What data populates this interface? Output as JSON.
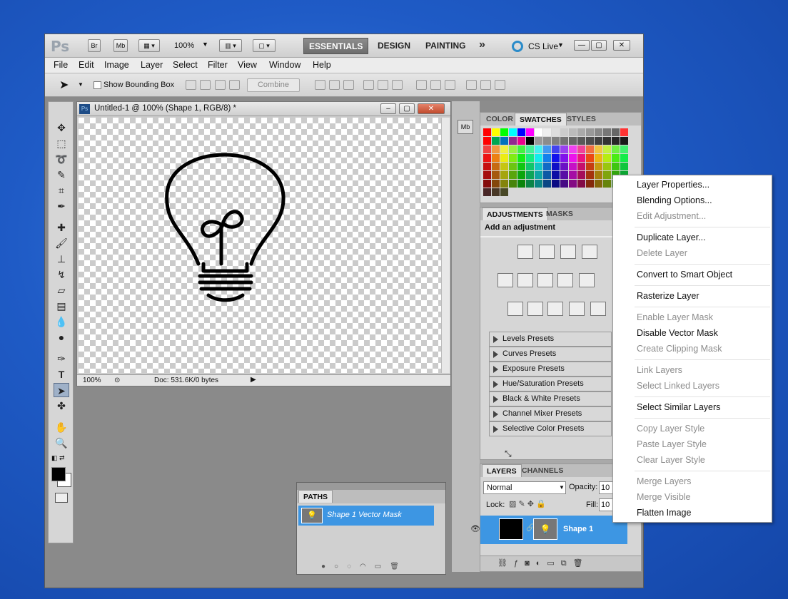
{
  "app": {
    "logo": "Ps",
    "bridge": "Br",
    "minibridge": "Mb",
    "zoom": "100%",
    "workspaces": [
      "ESSENTIALS",
      "DESIGN",
      "PAINTING"
    ],
    "more": "»",
    "cslive": "CS Live"
  },
  "menubar": [
    "File",
    "Edit",
    "Image",
    "Layer",
    "Select",
    "Filter",
    "View",
    "Window",
    "Help"
  ],
  "options": {
    "show_bounding_box": "Show Bounding Box",
    "combine": "Combine"
  },
  "document": {
    "title": "Untitled-1 @ 100% (Shape 1, RGB/8) *",
    "zoom": "100%",
    "doc_info": "Doc: 531.6K/0 bytes"
  },
  "color_panel": {
    "tabs": [
      "COLOR",
      "SWATCHES",
      "STYLES"
    ]
  },
  "adjustments": {
    "tabs": [
      "ADJUSTMENTS",
      "MASKS"
    ],
    "heading": "Add an adjustment",
    "presets": [
      "Levels Presets",
      "Curves Presets",
      "Exposure Presets",
      "Hue/Saturation Presets",
      "Black & White Presets",
      "Channel Mixer Presets",
      "Selective Color Presets"
    ]
  },
  "layers": {
    "tabs": [
      "LAYERS",
      "CHANNELS"
    ],
    "blend_mode": "Normal",
    "opacity_label": "Opacity:",
    "opacity_value": "10",
    "lock_label": "Lock:",
    "fill_label": "Fill:",
    "fill_value": "10",
    "layer_name": "Shape 1"
  },
  "paths": {
    "tab": "PATHS",
    "item": "Shape 1 Vector Mask"
  },
  "context_menu": [
    {
      "label": "Layer Properties...",
      "enabled": true
    },
    {
      "label": "Blending Options...",
      "enabled": true
    },
    {
      "label": "Edit Adjustment...",
      "enabled": false
    },
    {
      "label": "Duplicate Layer...",
      "enabled": true
    },
    {
      "label": "Delete Layer",
      "enabled": false
    },
    {
      "label": "Convert to Smart Object",
      "enabled": true
    },
    {
      "label": "Rasterize Layer",
      "enabled": true
    },
    {
      "label": "Enable Layer Mask",
      "enabled": false
    },
    {
      "label": "Disable Vector Mask",
      "enabled": true
    },
    {
      "label": "Create Clipping Mask",
      "enabled": false
    },
    {
      "label": "Link Layers",
      "enabled": false
    },
    {
      "label": "Select Linked Layers",
      "enabled": false
    },
    {
      "label": "Select Similar Layers",
      "enabled": true
    },
    {
      "label": "Copy Layer Style",
      "enabled": false
    },
    {
      "label": "Paste Layer Style",
      "enabled": false
    },
    {
      "label": "Clear Layer Style",
      "enabled": false
    },
    {
      "label": "Merge Layers",
      "enabled": false
    },
    {
      "label": "Merge Visible",
      "enabled": false
    },
    {
      "label": "Flatten Image",
      "enabled": true
    }
  ]
}
